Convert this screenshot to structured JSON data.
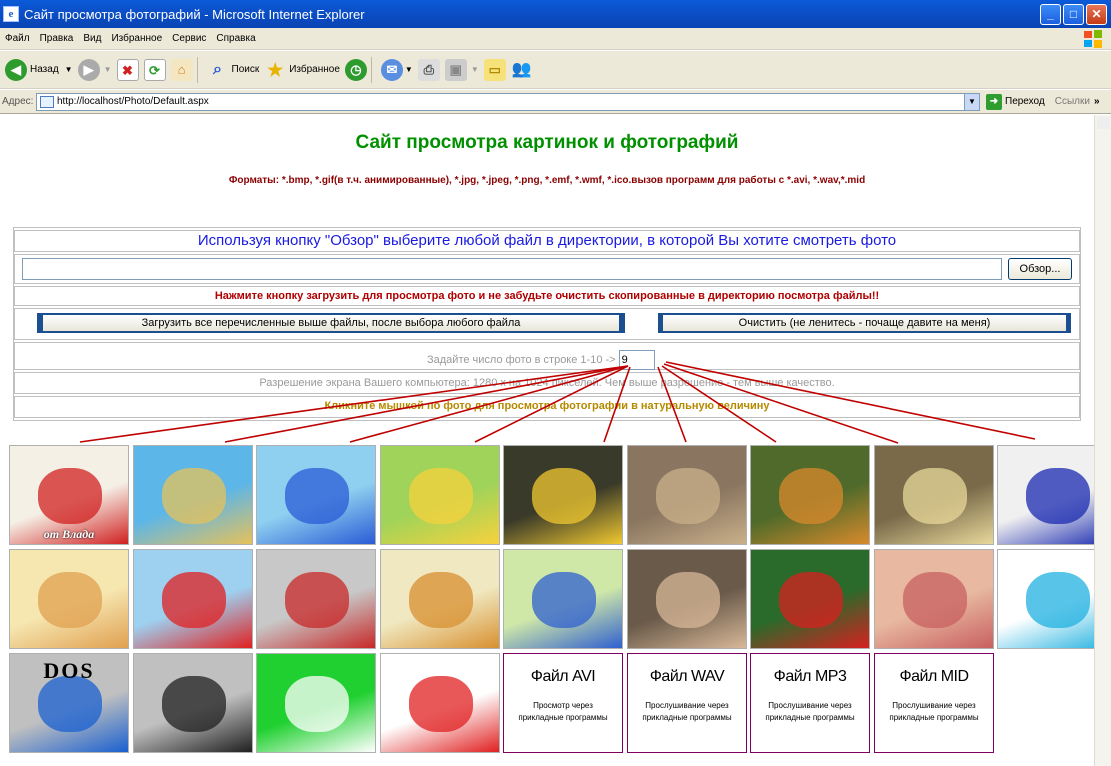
{
  "window": {
    "title": "Сайт просмотра фотографий - Microsoft Internet Explorer",
    "icon_glyph": "e"
  },
  "menu": [
    "Файл",
    "Правка",
    "Вид",
    "Избранное",
    "Сервис",
    "Справка"
  ],
  "toolbar": {
    "back_label": "Назад",
    "search_label": "Поиск",
    "favorites_label": "Избранное"
  },
  "address": {
    "label": "Адрес:",
    "url": "http://localhost/Photo/Default.aspx",
    "go_label": "Переход",
    "links_label": "Ссылки"
  },
  "page": {
    "heading": "Сайт просмотра картинок и фотографий",
    "formats": "Форматы: *.bmp, *.gif(в т.ч. анимированные), *.jpg, *.jpeg, *.png, *.emf, *.wmf, *.ico.вызов программ для работы с *.avi, *.wav,*.mid",
    "browse_hint": "Используя кнопку \"Обзор\" выберите любой файл в директории, в которой Вы хотите смотреть фото",
    "file_input_value": "",
    "browse_button": "Обзор...",
    "upload_hint": "Нажмите кнопку загрузить для просмотра фото и не забудьте очистить скопированные в директорию посмотра файлы!!",
    "load_button": "Загрузить все перечисленные выше файлы, после выбора любого файла",
    "clear_button": "Очистить (не ленитесь - почаще давите на меня)",
    "per_row_label": "Задайте число фото в строке 1-10 ->",
    "per_row_value": "9",
    "resolution_text": "Разрешение экрана Вашего компьютера: 1280 х на 1024 пикселей. Чем выше разрешение - тем выше качество.",
    "click_hint": "Кликните мышкой по фото для просмотра фотографии в натуральную величину"
  },
  "gallery": {
    "images": [
      {
        "name": "card-fan-thumbnail",
        "caption": "от Влада",
        "bg": "#f5f0e6",
        "accent": "#d02020"
      },
      {
        "name": "beach-volcano-thumbnail",
        "caption": "",
        "bg": "#5db6e8",
        "accent": "#e6c15a"
      },
      {
        "name": "mickey-car-thumbnail",
        "caption": "",
        "bg": "#8fd0f0",
        "accent": "#2a5bd6"
      },
      {
        "name": "donald-pluto-thumbnail",
        "caption": "",
        "bg": "#9fd35a",
        "accent": "#f7d23c"
      },
      {
        "name": "chicks-thumbnail",
        "caption": "",
        "bg": "#3a3a2a",
        "accent": "#f0c830"
      },
      {
        "name": "cat-face-thumbnail",
        "caption": "",
        "bg": "#8a7560",
        "accent": "#c9b08a"
      },
      {
        "name": "tiger-thumbnail",
        "caption": "",
        "bg": "#4f6a2a",
        "accent": "#d98a2c"
      },
      {
        "name": "butterfly-thumbnail",
        "caption": "",
        "bg": "#7a6a4a",
        "accent": "#e8d89a"
      },
      {
        "name": "blue-truck-thumbnail",
        "caption": "",
        "bg": "#f0f0f0",
        "accent": "#1a2ab0"
      },
      {
        "name": "cartoon-cat-thumbnail",
        "caption": "",
        "bg": "#f6e6b0",
        "accent": "#e0a050"
      },
      {
        "name": "tractor-thumbnail",
        "caption": "",
        "bg": "#9ed0f0",
        "accent": "#e02020"
      },
      {
        "name": "castle-thumbnail",
        "caption": "",
        "bg": "#c8c8c8",
        "accent": "#c82828"
      },
      {
        "name": "lion-thumbnail",
        "caption": "",
        "bg": "#f0e8c0",
        "accent": "#d89030"
      },
      {
        "name": "village-thumbnail",
        "caption": "",
        "bg": "#cfe8a8",
        "accent": "#3060d0"
      },
      {
        "name": "woman-portrait-thumbnail",
        "caption": "",
        "bg": "#6a5a4a",
        "accent": "#d8b898"
      },
      {
        "name": "parrot-thumbnail",
        "caption": "",
        "bg": "#2a6a2a",
        "accent": "#d82020"
      },
      {
        "name": "roses-girl-thumbnail",
        "caption": "",
        "bg": "#e8b8a0",
        "accent": "#c86060"
      },
      {
        "name": "pixel-man-thumbnail",
        "caption": "",
        "bg": "#ffffff",
        "accent": "#20b0e0"
      },
      {
        "name": "dos-compass-thumbnail",
        "caption": "DOS",
        "bg": "#c0c0c0",
        "accent": "#1a60d0"
      },
      {
        "name": "skull-thumbnail",
        "caption": "",
        "bg": "#c0c0c0",
        "accent": "#202020"
      },
      {
        "name": "flower-thumbnail",
        "caption": "",
        "bg": "#20d030",
        "accent": "#ffffff"
      },
      {
        "name": "hand-cross-thumbnail",
        "caption": "",
        "bg": "#ffffff",
        "accent": "#e02020"
      }
    ],
    "files": [
      {
        "title": "Файл AVI",
        "desc": "Просмотр через прикладные программы"
      },
      {
        "title": "Файл WAV",
        "desc": "Прослушивание через прикладные программы"
      },
      {
        "title": "Файл MP3",
        "desc": "Прослушивание через прикладные программы"
      },
      {
        "title": "Файл MID",
        "desc": "Прослушивание через прикладные программы"
      }
    ]
  }
}
